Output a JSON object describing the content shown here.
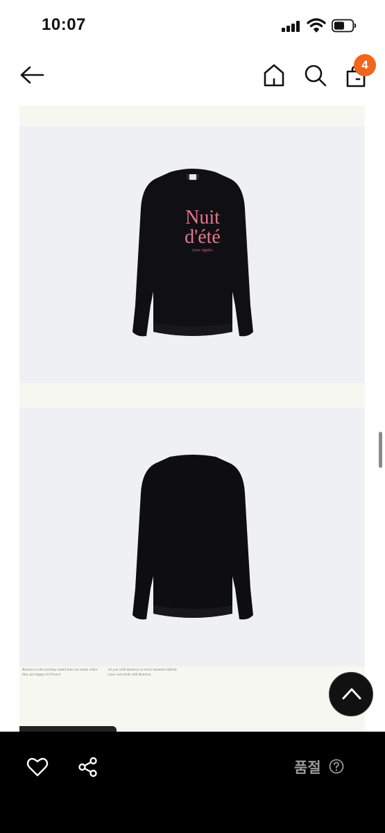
{
  "status_bar": {
    "time": "10:07"
  },
  "header": {
    "cart_count": "4"
  },
  "product_images": {
    "front_print_line1": "Nuit",
    "front_print_line2": "d'été",
    "front_print_sub": "Love Apples",
    "caption_left": "Romeva is the parting sound that can make when they are happy in French",
    "caption_right": "be you with Romeva in every moment refresh your own look with Romeva"
  },
  "bottom_bar": {
    "status_label": "품절"
  },
  "colors": {
    "accent": "#f2651d",
    "bar_background": "#000000",
    "print_pink": "#e7768e"
  }
}
